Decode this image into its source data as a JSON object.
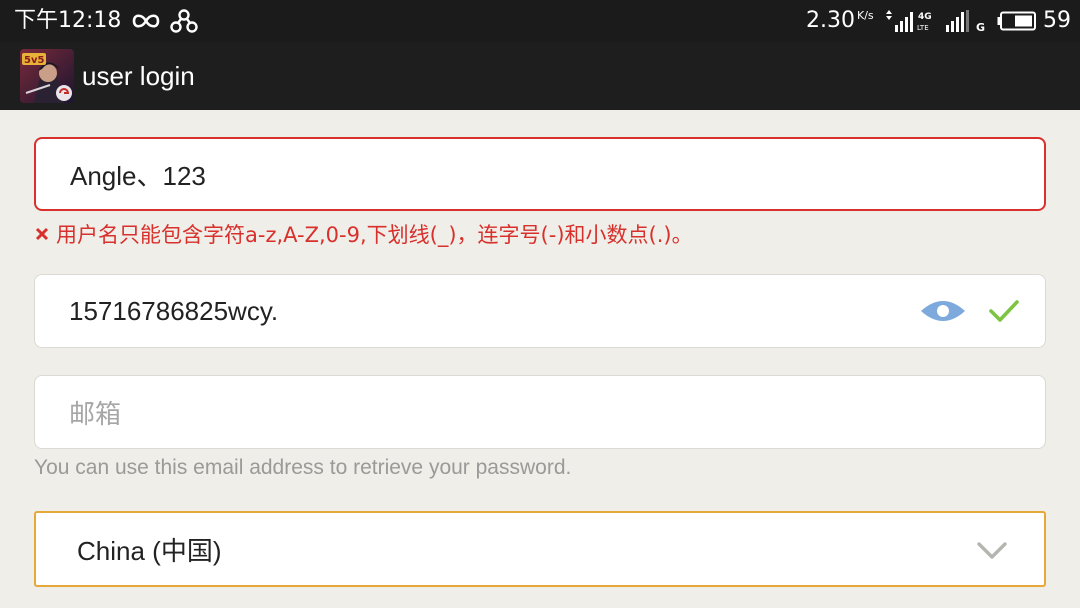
{
  "status_bar": {
    "time": "下午12:18",
    "net_speed": "2.30",
    "net_speed_unit": "K/s",
    "battery": "59",
    "icons": [
      "infinity-icon",
      "nodes-icon",
      "signal-4g-icon",
      "signal-g-icon",
      "battery-icon"
    ]
  },
  "app_bar": {
    "title": "user login",
    "icon": "game-app-icon"
  },
  "form": {
    "username": {
      "value": "Angle、123",
      "error": "用户名只能包含字符a-z,A-Z,0-9,下划线(_)，连字号(-)和小数点(.)。"
    },
    "password": {
      "value": "15716786825wcy.",
      "icons": [
        "eye-icon",
        "check-icon"
      ]
    },
    "email": {
      "value": "",
      "placeholder": "邮箱",
      "helper": "You can use this email address to retrieve your password."
    },
    "country": {
      "selected": "China (中国)"
    }
  },
  "colors": {
    "error": "#d8302c",
    "focus": "#e7a83a",
    "valid": "#7cc441",
    "eye": "#7ea9dc",
    "background": "#efeee8"
  }
}
